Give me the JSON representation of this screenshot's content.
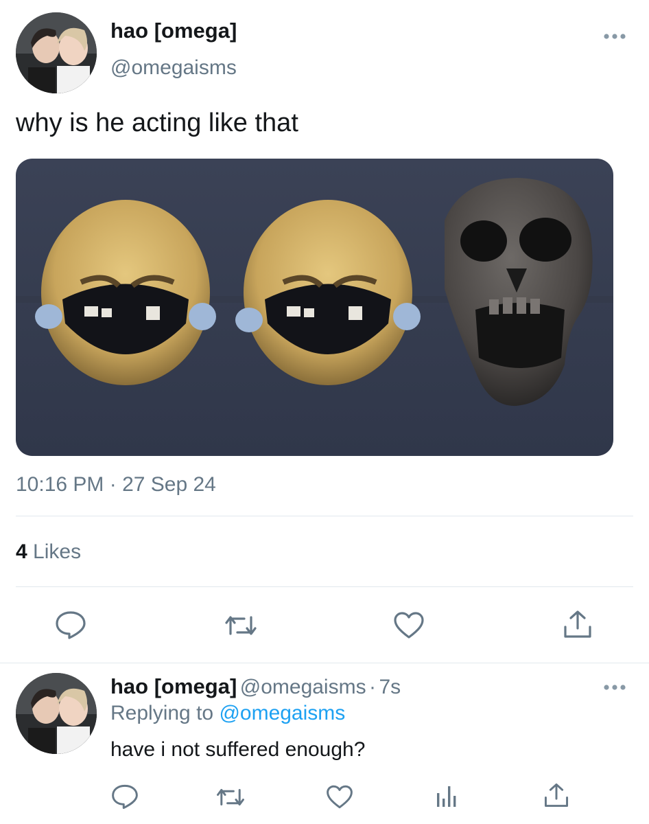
{
  "tweet": {
    "display_name": "hao [omega]",
    "handle": "@omegaisms",
    "text": "why is he acting like that",
    "timestamp": "10:16 PM · 27 Sep 24",
    "likes_count": "4",
    "likes_label": "Likes"
  },
  "reply": {
    "display_name": "hao [omega]",
    "handle": "@omegaisms",
    "separator": "·",
    "age": "7s",
    "replying_prefix": "Replying to",
    "replying_handle": "@omegaisms",
    "text": "have i not suffered enough?"
  },
  "icons": [
    "more-icon",
    "reply-icon",
    "retweet-icon",
    "like-icon",
    "share-icon",
    "analytics-icon"
  ],
  "colors": {
    "text": "#14171a",
    "secondary": "#657786",
    "link": "#1da1f2",
    "divider": "#e1e8ed"
  }
}
